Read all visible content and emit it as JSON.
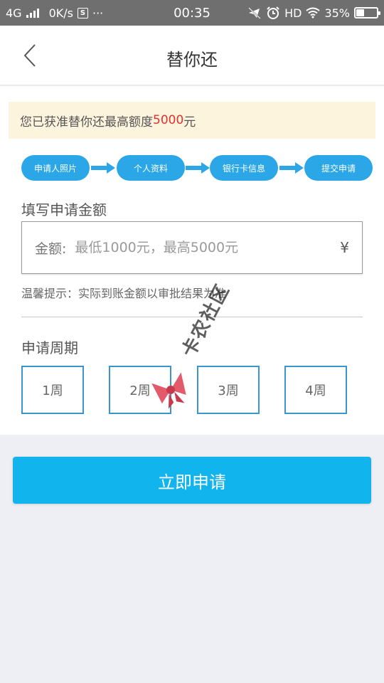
{
  "status_bar": {
    "network": "4G",
    "speed": "0K/s",
    "s_badge": "S",
    "more": "···",
    "time": "00:35",
    "hd": "HD",
    "battery": "35%",
    "battery_level": 0.35
  },
  "header": {
    "title": "替你还",
    "back_icon": "chevron-left-icon"
  },
  "notice": {
    "prefix": "您已获准替你还最高额度",
    "amount": "5000",
    "suffix": "元",
    "amount_color": "#e0322f"
  },
  "steps": [
    {
      "label": "申请人照片"
    },
    {
      "label": "个人资料"
    },
    {
      "label": "银行卡信息"
    },
    {
      "label": "提交申请"
    }
  ],
  "amount_section": {
    "title": "填写申请金额",
    "label": "金额:",
    "placeholder": "最低1000元，最高5000元",
    "value": "",
    "currency": "¥",
    "tip": "温馨提示：实际到账金额以审批结果为准"
  },
  "period_section": {
    "title": "申请周期",
    "options": [
      "1周",
      "2周",
      "3周",
      "4周"
    ]
  },
  "watermark": {
    "text": "卡农社区"
  },
  "submit": {
    "label": "立即申请"
  },
  "colors": {
    "accent": "#11b4ec",
    "step_blue": "#2ba7e8",
    "notice_bg": "#fdf4dd",
    "week_border": "#3a94d0"
  }
}
